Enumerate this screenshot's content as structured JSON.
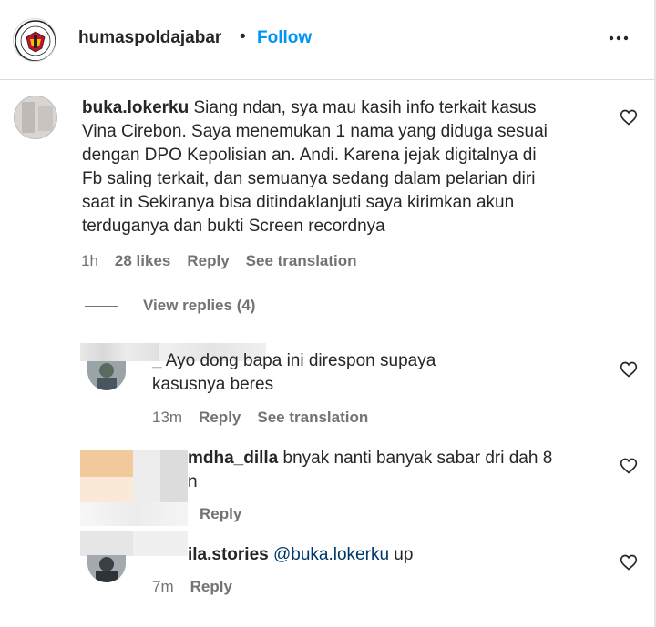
{
  "header": {
    "username": "humaspoldajabar",
    "separator": "•",
    "follow_label": "Follow",
    "logo_text": "POLDA JABAR"
  },
  "main_comment": {
    "username": "buka.lokerku",
    "line1": " Siang ndan, sya mau kasih info terkait kasus",
    "line2": "Vina Cirebon. Saya menemukan 1 nama yang diduga sesuai",
    "line3": "dengan DPO Kepolisian an. Andi. Karena jejak digitalnya di",
    "line4": "Fb saling terkait, dan semuanya sedang dalam pelarian diri",
    "line5": "saat in Sekiranya bisa ditindaklanjuti saya kirimkan akun",
    "line6": "terduganya dan bukti Screen recordnya",
    "time": "1h",
    "likes": "28 likes",
    "reply_label": "Reply",
    "translation_label": "See translation"
  },
  "view_replies_label": "View replies (4)",
  "replies": [
    {
      "username_visible": "_",
      "line1": " Ayo dong bapa ini direspon supaya",
      "line2": "kasusnya beres",
      "time": "13m",
      "reply_label": "Reply",
      "translation_label": "See translation"
    },
    {
      "username_visible": "mdha_dilla",
      "line1": " bnyak nanti banyak sabar dri dah 8",
      "line2": "n",
      "reply_label": "Reply"
    },
    {
      "username_visible": "ila.stories",
      "mention": "@buka.lokerku",
      "text_after": " up",
      "time": "7m",
      "reply_label": "Reply"
    }
  ],
  "colors": {
    "follow": "#0095f6",
    "text": "#262626",
    "muted": "#737373",
    "mention": "#00376b"
  }
}
